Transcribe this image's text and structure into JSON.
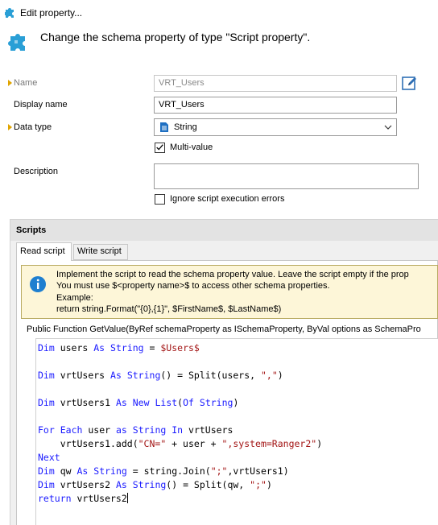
{
  "window": {
    "title": "Edit property..."
  },
  "header": {
    "text": "Change the schema property of type \"Script property\"."
  },
  "form": {
    "name_label": "Name",
    "name_value": "VRT_Users",
    "display_name_label": "Display name",
    "display_name_value": "VRT_Users",
    "data_type_label": "Data type",
    "data_type_value": "String",
    "multi_value_label": "Multi-value",
    "multi_value_checked": true,
    "description_label": "Description",
    "description_value": "",
    "ignore_errors_label": "Ignore script execution errors",
    "ignore_errors_checked": false
  },
  "scripts": {
    "section_title": "Scripts",
    "tabs": [
      "Read script",
      "Write script"
    ],
    "active_tab": "Read script",
    "info": {
      "line1": "Implement the script to read the schema property value. Leave the script empty if the prop",
      "line2": "You must use $<property name>$ to access other schema properties.",
      "line3": "Example:",
      "line4": "return string.Format(\"{0},{1}\", $FirstName$, $LastName$)"
    },
    "signature": "Public Function GetValue(ByRef schemaProperty as ISchemaProperty, ByVal options as SchemaPro",
    "code_lines": [
      "Dim users As String = $Users$",
      "",
      "Dim vrtUsers As String() = Split(users, \",\")",
      "",
      "Dim vrtUsers1 As New List(Of String)",
      "",
      "For Each user as String In vrtUsers",
      "    vrtUsers1.add(\"CN=\" + user + \",system=Ranger2\")",
      "Next",
      "Dim qw As String = string.Join(\";\",vrtUsers1)",
      "Dim vrtUsers2 As String() = Split(qw, \";\")",
      "return vrtUsers2"
    ]
  },
  "colors": {
    "keyword": "#1a1aff",
    "string": "#a31515",
    "info_background": "#fdf6d8",
    "required_marker": "#e0a400"
  },
  "icons": {
    "title": "puzzle-icon",
    "header": "puzzle-icon",
    "edit": "edit-icon",
    "data_type": "document-icon",
    "info": "info-icon"
  }
}
